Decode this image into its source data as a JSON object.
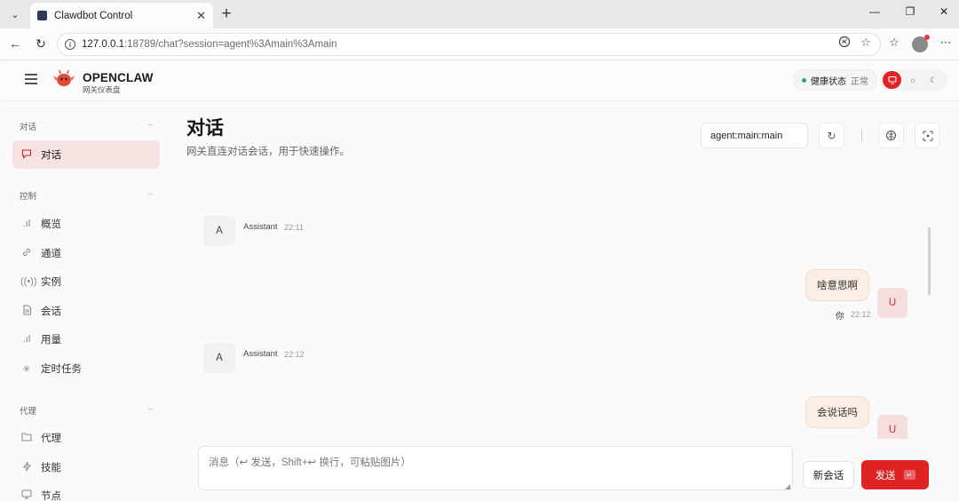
{
  "browser": {
    "tab_title": "Clawdbot Control",
    "url_host": "127.0.0.1",
    "url_path": ":18789/chat?session=agent%3Amain%3Amain",
    "icons": [
      "tab-search-icon",
      "back-icon",
      "reload-icon",
      "info-icon",
      "read-aloud-icon",
      "star-icon",
      "favorites-icon",
      "profile-avatar",
      "more-icon"
    ]
  },
  "header": {
    "brand": "OPENCLAW",
    "brand_sub": "网关仪表盘",
    "health_label": "健康状态",
    "health_value": "正常",
    "accent_color": "#e02424",
    "health_dot_color": "#27ae60"
  },
  "sidebar": {
    "sections": [
      {
        "title": "对话",
        "items": [
          {
            "label": "对话",
            "icon": "chat-icon",
            "active": true
          }
        ]
      },
      {
        "title": "控制",
        "items": [
          {
            "label": "概览",
            "icon": "bar-chart-icon"
          },
          {
            "label": "通道",
            "icon": "link-icon"
          },
          {
            "label": "实例",
            "icon": "broadcast-icon"
          },
          {
            "label": "会话",
            "icon": "document-icon"
          },
          {
            "label": "用量",
            "icon": "bar-chart-icon"
          },
          {
            "label": "定时任务",
            "icon": "loader-icon"
          }
        ]
      },
      {
        "title": "代理",
        "items": [
          {
            "label": "代理",
            "icon": "folder-icon"
          },
          {
            "label": "技能",
            "icon": "lightning-icon"
          },
          {
            "label": "节点",
            "icon": "monitor-icon"
          }
        ]
      }
    ]
  },
  "main": {
    "title": "对话",
    "subtitle": "网关直连对话会话，用于快速操作。",
    "session_value": "agent:main:main",
    "messages": [
      {
        "role": "assistant",
        "avatar": "A",
        "name": "Assistant",
        "time": "22:11"
      },
      {
        "role": "user",
        "avatar": "U",
        "name": "你",
        "text": "啥意思啊",
        "time": "22:12"
      },
      {
        "role": "assistant",
        "avatar": "A",
        "name": "Assistant",
        "time": "22:12"
      },
      {
        "role": "user",
        "avatar": "U",
        "text": "会说话吗"
      }
    ]
  },
  "composer": {
    "placeholder": "消息（↩ 发送，Shift+↩ 换行，可粘贴图片）",
    "new_session_label": "新会话",
    "send_label": "发送",
    "send_key_hint": "↵"
  }
}
